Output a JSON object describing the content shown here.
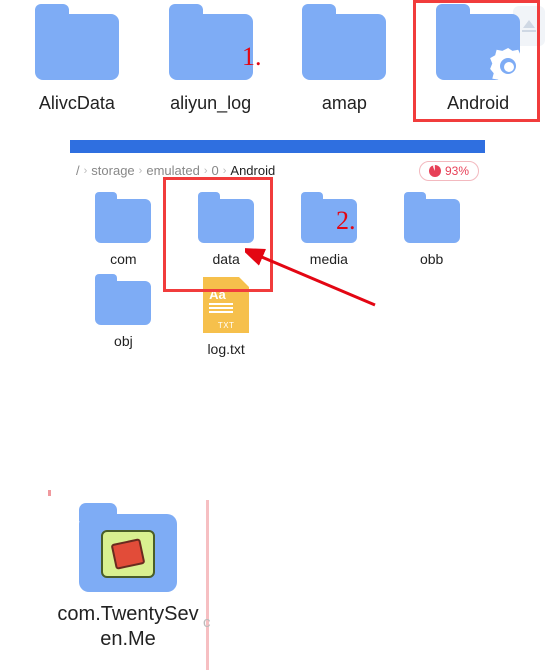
{
  "top_row": {
    "items": [
      {
        "label": "AlivcData"
      },
      {
        "label": "aliyun_log"
      },
      {
        "label": "amap"
      },
      {
        "label": "Android",
        "has_gear": true
      }
    ]
  },
  "annotation": {
    "step1": "1.",
    "step2": "2."
  },
  "breadcrumb": {
    "root": "/",
    "parts": [
      "storage",
      "emulated",
      "0"
    ],
    "current": "Android"
  },
  "usage": {
    "percent": "93%"
  },
  "mid_grid": {
    "row1": [
      {
        "label": "com"
      },
      {
        "label": "data"
      },
      {
        "label": "media"
      },
      {
        "label": "obb"
      }
    ],
    "row2": [
      {
        "label": "obj"
      },
      {
        "label": "log.txt",
        "type": "txt"
      }
    ]
  },
  "txt_badge": {
    "aa": "Aa",
    "ext": "TXT"
  },
  "bottom": {
    "label": "com.TwentySeven.Me"
  },
  "stray": {
    "c": "c"
  }
}
